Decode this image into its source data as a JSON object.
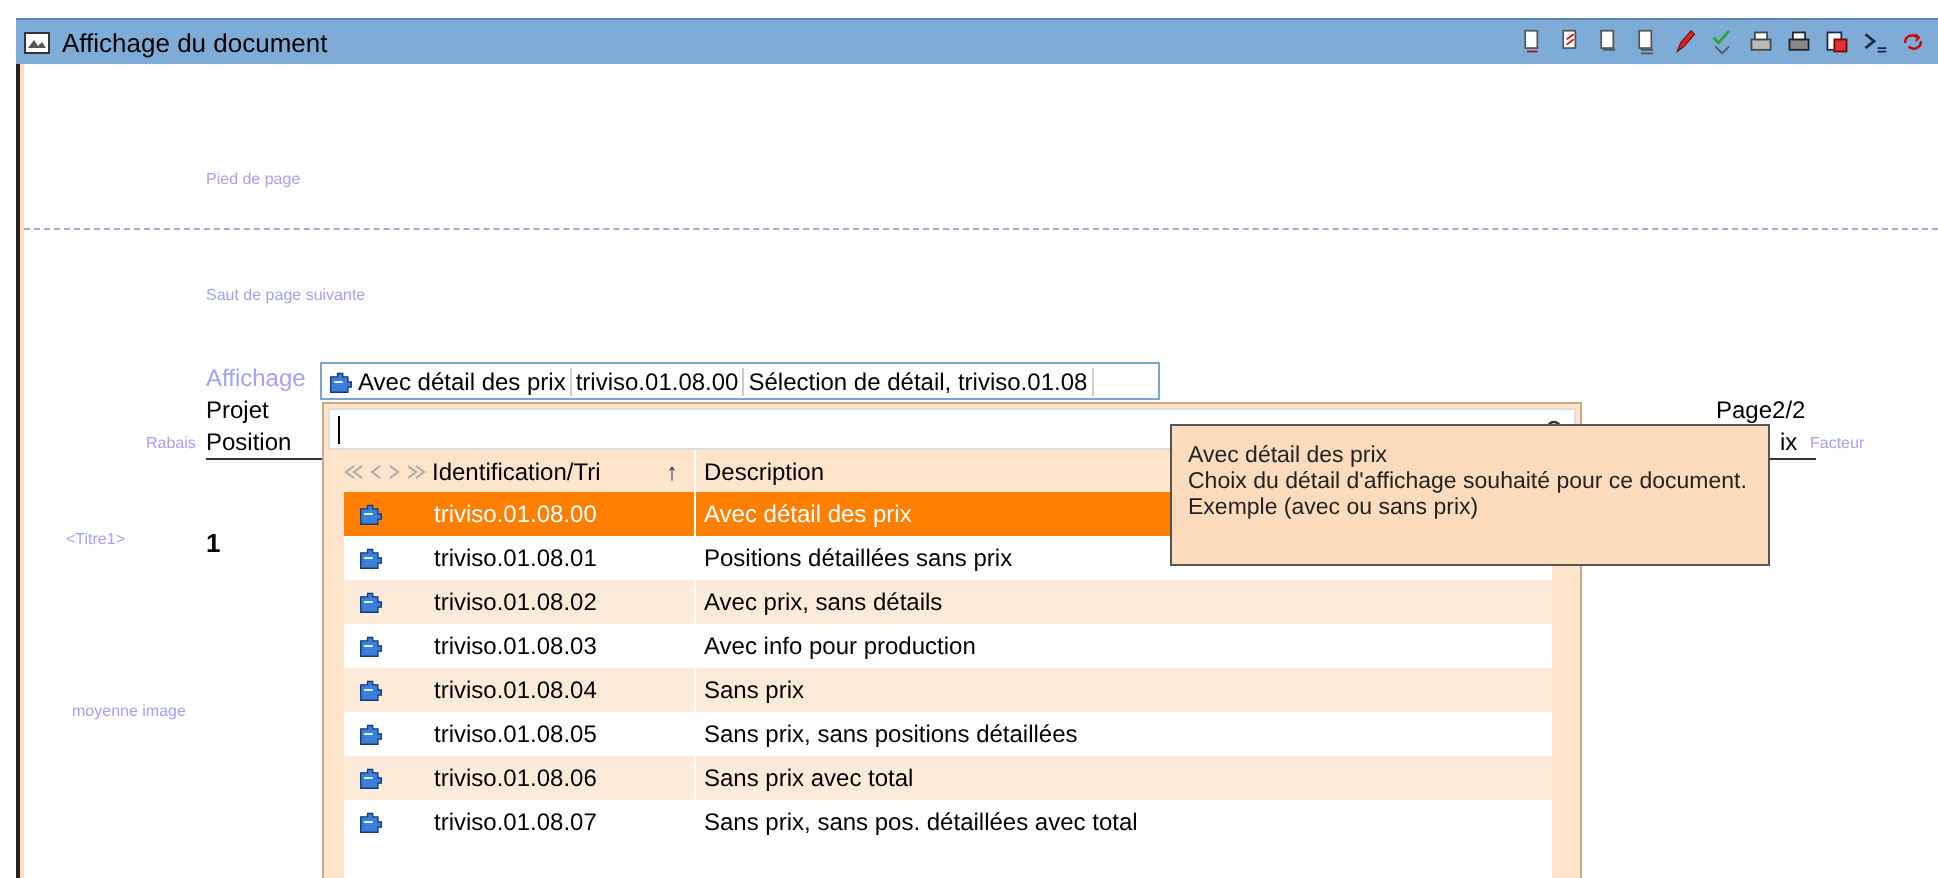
{
  "window": {
    "title": "Affichage du document"
  },
  "report": {
    "footer_band": "Pied de page",
    "page_break_band": "Saut de page suivante",
    "display_label": "Affichage",
    "project_label": "Projet",
    "position_label": "Position",
    "discount_label": "Rabais",
    "title_marker": "<Titre1>",
    "title_number": "1",
    "image_marker": "moyenne image",
    "page_number": "Page2/2",
    "price_label_fragment": "ix",
    "factor_label": "Facteur"
  },
  "display_combo": {
    "segments": [
      "Avec détail des prix",
      "triviso.01.08.00",
      "Sélection de détail, triviso.01.08"
    ]
  },
  "dropdown": {
    "columns": [
      {
        "label": "Identification/Tri",
        "sort": "↑"
      },
      {
        "label": "Description"
      }
    ],
    "rows": [
      {
        "id": "triviso.01.08.00",
        "description": "Avec détail des prix",
        "selected": true
      },
      {
        "id": "triviso.01.08.01",
        "description": "Positions détaillées sans prix",
        "selected": false
      },
      {
        "id": "triviso.01.08.02",
        "description": "Avec prix, sans détails",
        "selected": false
      },
      {
        "id": "triviso.01.08.03",
        "description": "Avec info pour production",
        "selected": false
      },
      {
        "id": "triviso.01.08.04",
        "description": "Sans prix",
        "selected": false
      },
      {
        "id": "triviso.01.08.05",
        "description": "Sans prix, sans positions détaillées",
        "selected": false
      },
      {
        "id": "triviso.01.08.06",
        "description": "Sans prix avec total",
        "selected": false
      },
      {
        "id": "triviso.01.08.07",
        "description": "Sans prix, sans pos. détaillées avec total",
        "selected": false
      }
    ]
  },
  "tooltip": {
    "lines": [
      "Avec détail des prix",
      "Choix du détail d'affichage souhaité pour ce document.",
      "Exemple (avec ou sans prix)"
    ]
  }
}
